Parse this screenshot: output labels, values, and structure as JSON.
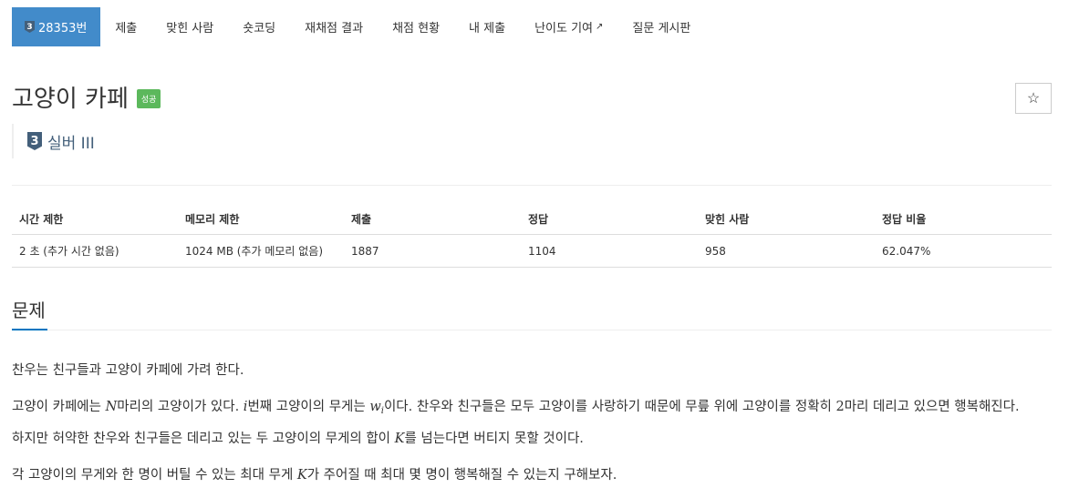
{
  "nav": {
    "problem_tier_digit": "3",
    "problem_number": "28353번",
    "tabs": [
      "제출",
      "맞힌 사람",
      "숏코딩",
      "재채점 결과",
      "채점 현황",
      "내 제출",
      "난이도 기여",
      "질문 게시판"
    ]
  },
  "problem": {
    "title": "고양이 카페",
    "status": "성공",
    "tier_digit": "3",
    "tier": "실버 III",
    "star": "☆"
  },
  "info": {
    "headers": [
      "시간 제한",
      "메모리 제한",
      "제출",
      "정답",
      "맞힌 사람",
      "정답 비율"
    ],
    "values": [
      "2 초 (추가 시간 없음)",
      "1024 MB (추가 메모리 없음)",
      "1887",
      "1104",
      "958",
      "62.047%"
    ]
  },
  "statement": {
    "section_title": "문제",
    "p1": "찬우는 친구들과 고양이 카페에 가려 한다.",
    "p2_a": "고양이 카페에는 ",
    "p2_N": "N",
    "p2_b": "마리의 고양이가 있다. ",
    "p2_i": "i",
    "p2_c": "번째 고양이의 무게는 ",
    "p2_w": "w",
    "p2_wsub": "i",
    "p2_d": "이다. 찬우와 친구들은 모두 고양이를 사랑하기 때문에 무릎 위에 고양이를 정확히 ",
    "p2_2": "2",
    "p2_e": "마리 데리고 있으면 행복해진다.",
    "p2_f": "하지만 허약한 찬우와 친구들은 데리고 있는 두 고양이의 무게의 합이 ",
    "p2_K": "K",
    "p2_g": "를 넘는다면 버티지 못할 것이다.",
    "p3_a": "각 고양이의 무게와 한 명이 버틸 수 있는 최대 무게 ",
    "p3_K": "K",
    "p3_b": "가 주어질 때 최대 몇 명이 행복해질 수 있는지 구해보자."
  },
  "colors": {
    "active_tab": "#428bca",
    "success": "#5cb85c",
    "tier_silver": "#435f7a",
    "section_underline": "#0076c0"
  }
}
